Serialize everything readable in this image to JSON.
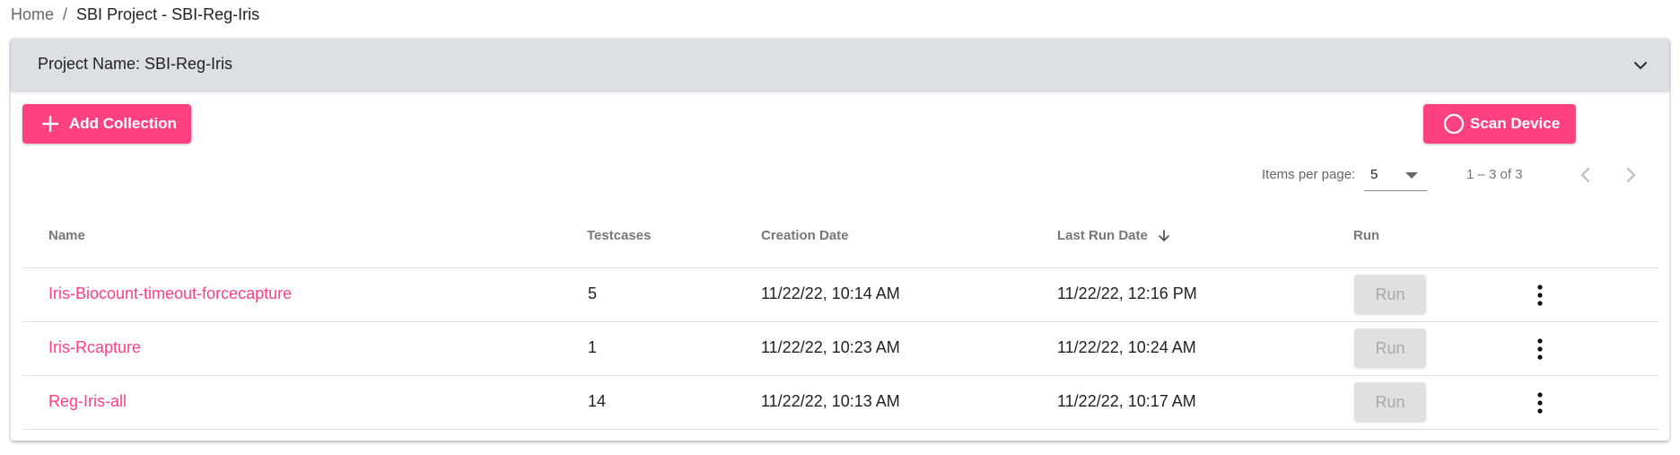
{
  "breadcrumb": {
    "home": "Home",
    "separator": "/",
    "current": "SBI Project - SBI-Reg-Iris"
  },
  "panel": {
    "title": "Project Name: SBI-Reg-Iris"
  },
  "buttons": {
    "add_collection": "Add Collection",
    "scan_device": "Scan Device"
  },
  "paginator": {
    "items_per_page_label": "Items per page:",
    "items_per_page": "5",
    "range": "1 – 3 of 3"
  },
  "table": {
    "headers": {
      "name": "Name",
      "testcases": "Testcases",
      "creation_date": "Creation Date",
      "last_run_date": "Last Run Date",
      "run": "Run"
    },
    "rows": [
      {
        "name": "Iris-Biocount-timeout-forcecapture",
        "testcases": "5",
        "creation_date": "11/22/22, 10:14 AM",
        "last_run_date": "11/22/22, 12:16 PM",
        "run": "Run"
      },
      {
        "name": "Iris-Rcapture",
        "testcases": "1",
        "creation_date": "11/22/22, 10:23 AM",
        "last_run_date": "11/22/22, 10:24 AM",
        "run": "Run"
      },
      {
        "name": "Reg-Iris-all",
        "testcases": "14",
        "creation_date": "11/22/22, 10:13 AM",
        "last_run_date": "11/22/22, 10:17 AM",
        "run": "Run"
      }
    ]
  },
  "icons": {
    "add": "plus-icon",
    "scan": "circle-icon",
    "expand": "chevron-down-icon",
    "sort": "arrow-down-icon",
    "prev": "chevron-left-icon",
    "next": "chevron-right-icon",
    "row_menu": "more-vert-icon"
  },
  "colors": {
    "accent": "#ff4081",
    "header_bg": "#dcdfe3",
    "disabled_bg": "#e0e0e0"
  }
}
